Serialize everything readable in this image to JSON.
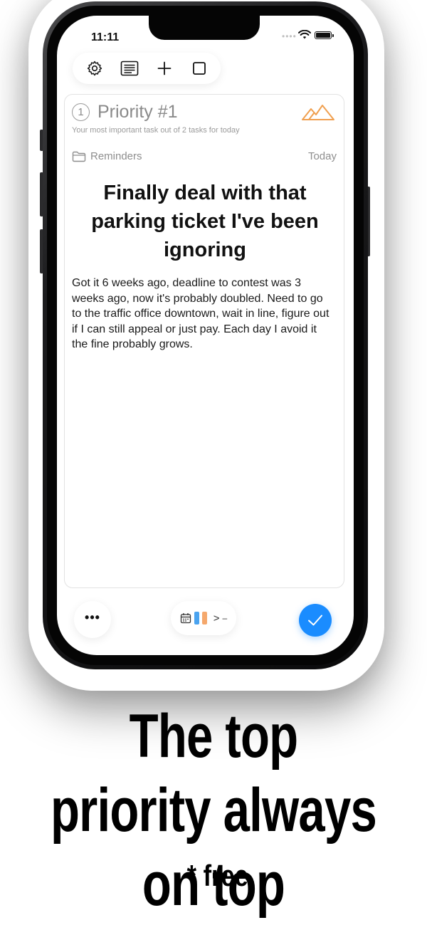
{
  "status_bar": {
    "time": "11:11",
    "signal_dots": "••••"
  },
  "toolbar": {
    "icons": [
      "gear-icon",
      "list-icon",
      "plus-icon",
      "square-icon"
    ]
  },
  "card": {
    "priority_number": "1",
    "priority_label": "Priority #1",
    "subtitle": "Your most important task out of 2 tasks for today",
    "list_name": "Reminders",
    "due": "Today",
    "title": "Finally deal with that parking ticket I've been ignoring",
    "notes": "Got it 6 weeks ago, deadline to contest was 3 weeks ago, now it's probably doubled. Need to go to the traffic office downtown, wait in line, figure out if I can still appeal or just pay. Each day I avoid it the fine probably grows."
  },
  "bottom_bar": {
    "more_label": "•••",
    "chevron": ">",
    "dash": "–"
  },
  "marketing": {
    "headline": "The top priority always on top",
    "note": "* free"
  },
  "colors": {
    "accent_blue": "#1a8cff",
    "mountain_orange": "#f0a050",
    "bar_blue": "#4aa3ef",
    "bar_orange": "#f5a86c",
    "muted_text": "#8e8e8e"
  }
}
